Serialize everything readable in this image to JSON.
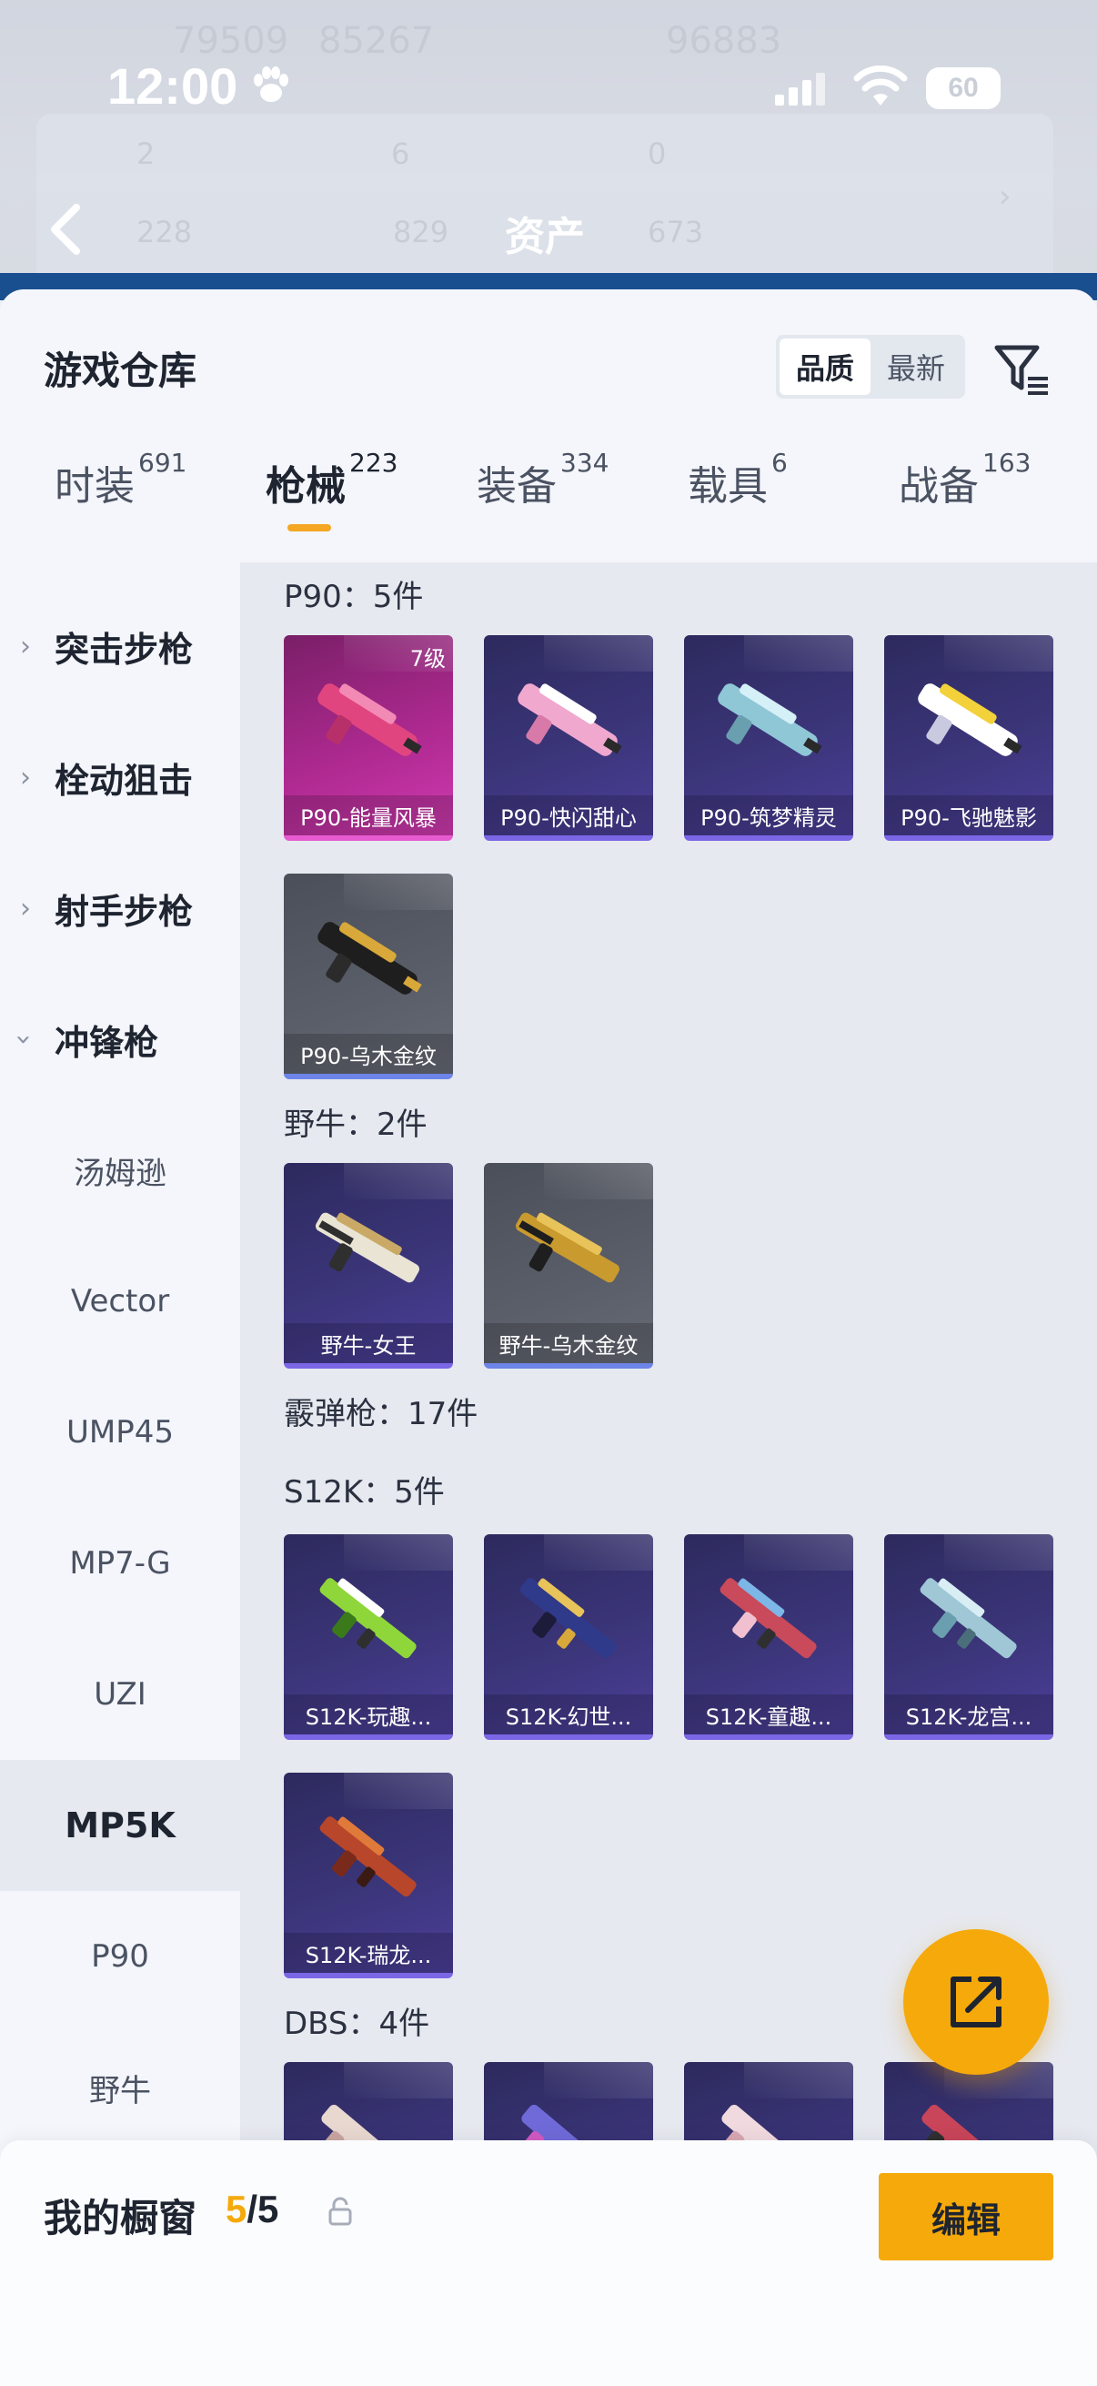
{
  "status_bar": {
    "time": "12:00",
    "battery": "60"
  },
  "background": {
    "title": "资产",
    "stats_row1": [
      "79509",
      "85267",
      "96883"
    ],
    "stats_row2": [
      "2",
      "6",
      "0"
    ],
    "stats_row3": [
      "228",
      "829",
      "673"
    ]
  },
  "sheet": {
    "title": "游戏仓库",
    "sort_options": [
      "品质",
      "最新"
    ],
    "tabs": [
      {
        "label": "时装",
        "count": "691"
      },
      {
        "label": "枪械",
        "count": "223"
      },
      {
        "label": "装备",
        "count": "334"
      },
      {
        "label": "载具",
        "count": "6"
      },
      {
        "label": "战备",
        "count": "163"
      }
    ]
  },
  "sidebar": {
    "categories": [
      "突击步枪",
      "栓动狙击",
      "射手步枪",
      "冲锋枪"
    ],
    "subitems": [
      "汤姆逊",
      "Vector",
      "UMP45",
      "MP7-G",
      "UZI",
      "MP5K",
      "P90",
      "野牛"
    ]
  },
  "groups": {
    "p90": {
      "title": "P90：5件",
      "items": [
        "P90-能量风暴",
        "P90-快闪甜心",
        "P90-筑梦精灵",
        "P90-飞驰魅影",
        "P90-乌木金纹"
      ],
      "level_badge": "7级"
    },
    "bison": {
      "title": "野牛：2件",
      "items": [
        "野牛-女王",
        "野牛-乌木金纹"
      ]
    },
    "shotgun": {
      "title": "霰弹枪：17件"
    },
    "s12k": {
      "title": "S12K：5件",
      "items": [
        "S12K-玩趣...",
        "S12K-幻世...",
        "S12K-童趣...",
        "S12K-龙宫...",
        "S12K-瑞龙..."
      ]
    },
    "dbs": {
      "title": "DBS：4件"
    }
  },
  "bottom_bar": {
    "label": "我的橱窗",
    "current": "5",
    "total": "/5",
    "edit_label": "编辑"
  },
  "colors": {
    "accent": "#f5a90a",
    "epic": "#4b3f99",
    "legendary": "#b12a93",
    "common": "#5a5e69"
  }
}
